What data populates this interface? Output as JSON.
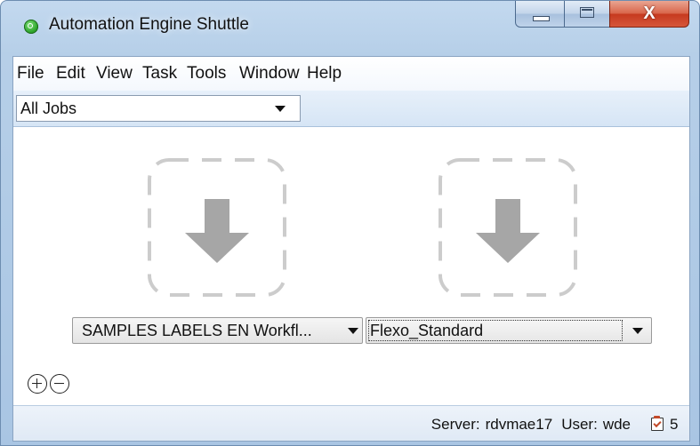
{
  "window": {
    "title": "Automation Engine Shuttle",
    "close_glyph": "X",
    "icons": {
      "app": "app-circle-icon",
      "minimize": "minimize-icon",
      "maximize": "maximize-icon",
      "close": "close-icon"
    }
  },
  "menu": {
    "file": "File",
    "edit": "Edit",
    "view": "View",
    "task": "Task",
    "tools": "Tools",
    "window": "Window",
    "help": "Help"
  },
  "jobs_filter": {
    "selected": "All Jobs"
  },
  "drop_zones": {
    "icon": "arrow-down-icon",
    "color": "#a6a6a6"
  },
  "hotfolder": {
    "selected": "SAMPLES LABELS EN Workfl..."
  },
  "ticket": {
    "selected": "Flexo_Standard"
  },
  "status": {
    "server_label": "Server:",
    "server_value": "rdvmae17",
    "user_label": "User:",
    "user_value": "wde",
    "task_count": "5"
  },
  "colors": {
    "accent": "#2fa62c",
    "close_button": "#c63a1f",
    "window_frame": "#a9c5e3"
  }
}
